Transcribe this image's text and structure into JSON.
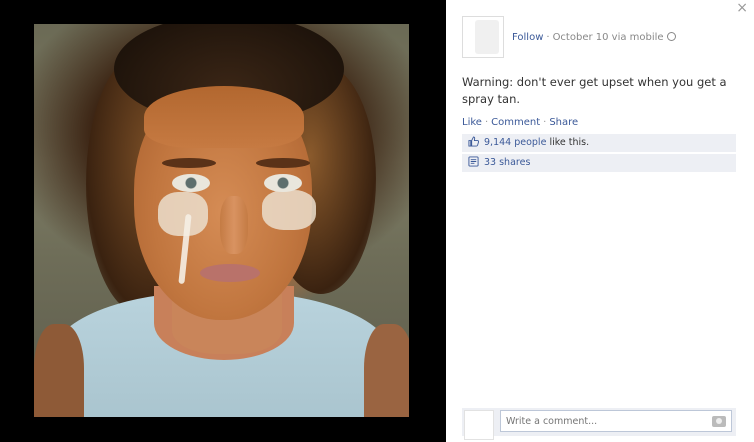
{
  "post": {
    "follow_label": "Follow",
    "separator": "·",
    "date": "October 10 via mobile",
    "message": "Warning: don't ever get upset when you get a spray tan."
  },
  "actions": {
    "like": "Like",
    "comment": "Comment",
    "share": "Share",
    "dot": "·"
  },
  "ufi": {
    "likes_link": "9,144 people",
    "likes_suffix": " like this.",
    "shares": "33 shares"
  },
  "comment": {
    "placeholder": "Write a comment..."
  },
  "close_symbol": "×",
  "icons": {
    "like": "thumbs-up-icon",
    "shares": "share-icon",
    "visibility": "globe-icon",
    "camera": "camera-icon",
    "close": "close-icon"
  },
  "colors": {
    "link": "#3b5998",
    "ufi_bg": "#edeff4",
    "viewer_bg": "#000000"
  }
}
